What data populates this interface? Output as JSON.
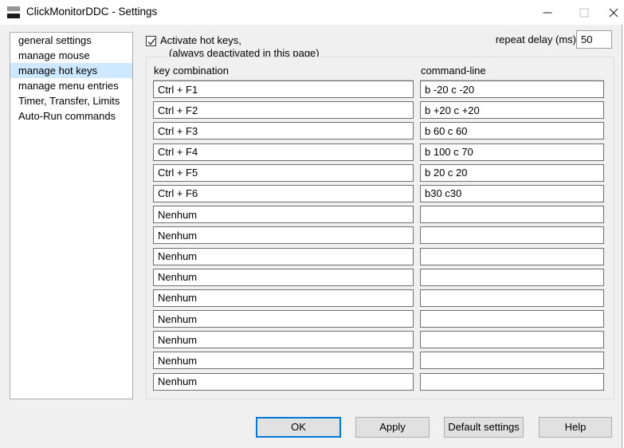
{
  "window": {
    "title": "ClickMonitorDDC - Settings",
    "icon": "monitor-icon",
    "controls": {
      "minimize": "minimize-icon",
      "maximize": "maximize-icon",
      "close": "close-icon"
    }
  },
  "sidebar": {
    "items": [
      {
        "label": "general settings",
        "selected": false
      },
      {
        "label": "manage mouse",
        "selected": false
      },
      {
        "label": "manage hot keys",
        "selected": true
      },
      {
        "label": "manage menu entries",
        "selected": false
      },
      {
        "label": "Timer, Transfer, Limits",
        "selected": false
      },
      {
        "label": "Auto-Run commands",
        "selected": false
      }
    ],
    "selected_color": "#cde8ff"
  },
  "options": {
    "activate_hotkeys": {
      "checked": true,
      "line1": "Activate hot keys,",
      "line2": "(always deactivated in this page)"
    },
    "repeat_delay": {
      "label": "repeat delay (ms)",
      "value": "50",
      "placeholder": ""
    }
  },
  "panel": {
    "columns": {
      "key": "key combination",
      "command": "command-line"
    },
    "rows": [
      {
        "key": "Ctrl + F1",
        "command": "b -20 c -20"
      },
      {
        "key": "Ctrl + F2",
        "command": "b +20 c +20"
      },
      {
        "key": "Ctrl + F3",
        "command": "b 60 c 60"
      },
      {
        "key": "Ctrl + F4",
        "command": "b 100 c 70"
      },
      {
        "key": "Ctrl + F5",
        "command": "b 20 c 20"
      },
      {
        "key": "Ctrl + F6",
        "command": "b30 c30"
      },
      {
        "key": "Nenhum",
        "command": ""
      },
      {
        "key": "Nenhum",
        "command": ""
      },
      {
        "key": "Nenhum",
        "command": ""
      },
      {
        "key": "Nenhum",
        "command": ""
      },
      {
        "key": "Nenhum",
        "command": ""
      },
      {
        "key": "Nenhum",
        "command": ""
      },
      {
        "key": "Nenhum",
        "command": ""
      },
      {
        "key": "Nenhum",
        "command": ""
      },
      {
        "key": "Nenhum",
        "command": ""
      }
    ]
  },
  "buttons": {
    "ok": "OK",
    "apply": "Apply",
    "default_settings": "Default settings",
    "help": "Help",
    "focus_color": "#0078d7"
  }
}
